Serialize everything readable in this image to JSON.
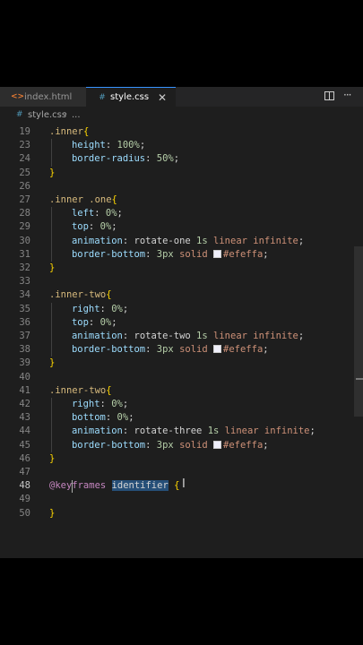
{
  "tabs": [
    {
      "label": "index.html",
      "icon": "html-file-icon"
    },
    {
      "label": "style.css",
      "icon": "css-file-icon",
      "close": "✕"
    }
  ],
  "breadcrumb": {
    "file": "style.css",
    "sep": "›",
    "ellipsis": "..."
  },
  "code": {
    "active_line": 48,
    "lines": [
      {
        "n": "19",
        "parts": [
          [
            ".inner",
            "t-sel"
          ],
          [
            "{",
            "t-brace"
          ]
        ]
      },
      {
        "n": "23",
        "indent": 2,
        "parts": [
          [
            "height",
            "t-prop"
          ],
          [
            ": ",
            "t-punct"
          ],
          [
            "100%",
            "t-num"
          ],
          [
            ";",
            "t-punct"
          ]
        ]
      },
      {
        "n": "24",
        "indent": 2,
        "parts": [
          [
            "border-radius",
            "t-prop"
          ],
          [
            ": ",
            "t-punct"
          ],
          [
            "50%",
            "t-num"
          ],
          [
            ";",
            "t-punct"
          ]
        ]
      },
      {
        "n": "25",
        "parts": [
          [
            "}",
            "t-brace"
          ]
        ]
      },
      {
        "n": "26",
        "parts": []
      },
      {
        "n": "27",
        "parts": [
          [
            ".inner .one",
            "t-sel"
          ],
          [
            "{",
            "t-brace"
          ]
        ]
      },
      {
        "n": "28",
        "indent": 2,
        "parts": [
          [
            "left",
            "t-prop"
          ],
          [
            ": ",
            "t-punct"
          ],
          [
            "0%",
            "t-num"
          ],
          [
            ";",
            "t-punct"
          ]
        ]
      },
      {
        "n": "29",
        "indent": 2,
        "parts": [
          [
            "top",
            "t-prop"
          ],
          [
            ": ",
            "t-punct"
          ],
          [
            "0%",
            "t-num"
          ],
          [
            ";",
            "t-punct"
          ]
        ]
      },
      {
        "n": "30",
        "indent": 2,
        "parts": [
          [
            "animation",
            "t-prop"
          ],
          [
            ": ",
            "t-punct"
          ],
          [
            "rotate-one ",
            "t-name"
          ],
          [
            "1s",
            "t-num"
          ],
          [
            " ",
            "t-punct"
          ],
          [
            "linear infinite",
            "t-linear"
          ],
          [
            ";",
            "t-punct"
          ]
        ]
      },
      {
        "n": "31",
        "indent": 2,
        "parts": [
          [
            "border-bottom",
            "t-prop"
          ],
          [
            ": ",
            "t-punct"
          ],
          [
            "3px",
            "t-num"
          ],
          [
            " ",
            "t-punct"
          ],
          [
            "solid",
            "t-kw"
          ],
          [
            " ",
            "t-punct"
          ],
          [
            "SWATCH",
            "swatch"
          ],
          [
            "#efeffa",
            "t-color"
          ],
          [
            ";",
            "t-punct"
          ]
        ]
      },
      {
        "n": "32",
        "parts": [
          [
            "}",
            "t-brace"
          ]
        ]
      },
      {
        "n": "33",
        "parts": []
      },
      {
        "n": "34",
        "parts": [
          [
            ".inner-two",
            "t-sel"
          ],
          [
            "{",
            "t-brace"
          ]
        ]
      },
      {
        "n": "35",
        "indent": 2,
        "parts": [
          [
            "right",
            "t-prop"
          ],
          [
            ": ",
            "t-punct"
          ],
          [
            "0%",
            "t-num"
          ],
          [
            ";",
            "t-punct"
          ]
        ]
      },
      {
        "n": "36",
        "indent": 2,
        "parts": [
          [
            "top",
            "t-prop"
          ],
          [
            ": ",
            "t-punct"
          ],
          [
            "0%",
            "t-num"
          ],
          [
            ";",
            "t-punct"
          ]
        ]
      },
      {
        "n": "37",
        "indent": 2,
        "parts": [
          [
            "animation",
            "t-prop"
          ],
          [
            ": ",
            "t-punct"
          ],
          [
            "rotate-two ",
            "t-name"
          ],
          [
            "1s",
            "t-num"
          ],
          [
            " ",
            "t-punct"
          ],
          [
            "linear infinite",
            "t-linear"
          ],
          [
            ";",
            "t-punct"
          ]
        ]
      },
      {
        "n": "38",
        "indent": 2,
        "parts": [
          [
            "border-bottom",
            "t-prop"
          ],
          [
            ": ",
            "t-punct"
          ],
          [
            "3px",
            "t-num"
          ],
          [
            " ",
            "t-punct"
          ],
          [
            "solid",
            "t-kw"
          ],
          [
            " ",
            "t-punct"
          ],
          [
            "SWATCH",
            "swatch"
          ],
          [
            "#efeffa",
            "t-color"
          ],
          [
            ";",
            "t-punct"
          ]
        ]
      },
      {
        "n": "39",
        "parts": [
          [
            "}",
            "t-brace"
          ]
        ]
      },
      {
        "n": "40",
        "parts": []
      },
      {
        "n": "41",
        "parts": [
          [
            ".inner-two",
            "t-sel"
          ],
          [
            "{",
            "t-brace"
          ]
        ]
      },
      {
        "n": "42",
        "indent": 2,
        "parts": [
          [
            "right",
            "t-prop"
          ],
          [
            ": ",
            "t-punct"
          ],
          [
            "0%",
            "t-num"
          ],
          [
            ";",
            "t-punct"
          ]
        ]
      },
      {
        "n": "43",
        "indent": 2,
        "parts": [
          [
            "bottom",
            "t-prop"
          ],
          [
            ": ",
            "t-punct"
          ],
          [
            "0%",
            "t-num"
          ],
          [
            ";",
            "t-punct"
          ]
        ]
      },
      {
        "n": "44",
        "indent": 2,
        "parts": [
          [
            "animation",
            "t-prop"
          ],
          [
            ": ",
            "t-punct"
          ],
          [
            "rotate-three ",
            "t-name"
          ],
          [
            "1s",
            "t-num"
          ],
          [
            " ",
            "t-punct"
          ],
          [
            "linear infinite",
            "t-linear"
          ],
          [
            ";",
            "t-punct"
          ]
        ]
      },
      {
        "n": "45",
        "indent": 2,
        "parts": [
          [
            "border-bottom",
            "t-prop"
          ],
          [
            ": ",
            "t-punct"
          ],
          [
            "3px",
            "t-num"
          ],
          [
            " ",
            "t-punct"
          ],
          [
            "solid",
            "t-kw"
          ],
          [
            " ",
            "t-punct"
          ],
          [
            "SWATCH",
            "swatch"
          ],
          [
            "#efeffa",
            "t-color"
          ],
          [
            ";",
            "t-punct"
          ]
        ]
      },
      {
        "n": "46",
        "parts": [
          [
            "}",
            "t-brace"
          ]
        ]
      },
      {
        "n": "47",
        "parts": []
      },
      {
        "n": "48",
        "parts": [
          [
            "@keyframes",
            "t-at"
          ],
          [
            " ",
            "t-punct"
          ],
          [
            "identifier",
            "t-ident"
          ],
          [
            " ",
            "t-punct"
          ],
          [
            "{",
            "t-brace"
          ]
        ]
      },
      {
        "n": "49",
        "parts": []
      },
      {
        "n": "50",
        "parts": [
          [
            "}",
            "t-brace"
          ]
        ]
      }
    ]
  },
  "colors": {
    "background": "#1e1e1e",
    "selector": "#d7ba7d",
    "property": "#9cdcfe",
    "number": "#b5cea8",
    "keyword": "#ce9178",
    "at_rule": "#c586c0",
    "swatch": "#efeffa"
  }
}
